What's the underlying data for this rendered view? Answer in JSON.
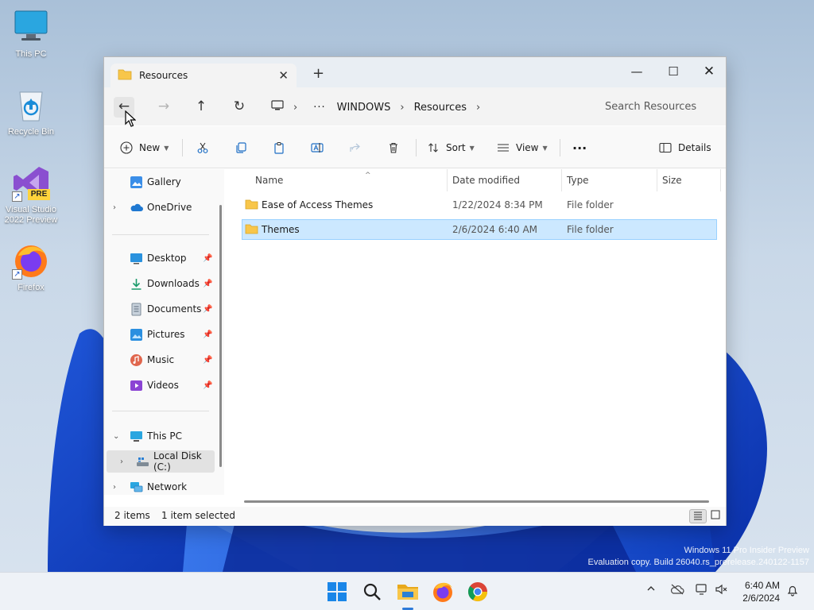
{
  "desktop": {
    "icons": [
      {
        "label": "This PC"
      },
      {
        "label": "Recycle Bin"
      },
      {
        "label": "Visual Studio 2022 Preview",
        "badge": "PRE"
      },
      {
        "label": "Firefox"
      }
    ],
    "watermark": {
      "line1": "Windows 11 Pro Insider Preview",
      "line2": "Evaluation copy. Build 26040.rs_prerelease.240122-1157"
    }
  },
  "window": {
    "tab": {
      "title": "Resources",
      "close_glyph": "✕"
    },
    "new_tab_glyph": "+",
    "controls": {
      "minimize": "—",
      "maximize": "☐",
      "close": "✕"
    },
    "nav": {
      "back": "←",
      "forward": "→",
      "up": "↑",
      "refresh": "↻"
    },
    "address": {
      "more": "···",
      "separator": "›",
      "crumbs": [
        "WINDOWS",
        "Resources"
      ]
    },
    "search_placeholder": "Search Resources",
    "commands": {
      "new": "New",
      "sort": "Sort",
      "view": "View",
      "more": "···",
      "details": "Details"
    },
    "sidebar": {
      "gallery": "Gallery",
      "onedrive": "OneDrive",
      "desktop": "Desktop",
      "downloads": "Downloads",
      "documents": "Documents",
      "pictures": "Pictures",
      "music": "Music",
      "videos": "Videos",
      "thispc": "This PC",
      "localdisk": "Local Disk (C:)",
      "network": "Network"
    },
    "columns": {
      "name": "Name",
      "date": "Date modified",
      "type": "Type",
      "size": "Size"
    },
    "files": [
      {
        "name": "Ease of Access Themes",
        "date": "1/22/2024 8:34 PM",
        "type": "File folder"
      },
      {
        "name": "Themes",
        "date": "2/6/2024 6:40 AM",
        "type": "File folder"
      }
    ],
    "status": {
      "count": "2 items",
      "selection": "1 item selected"
    }
  },
  "taskbar": {
    "time": "6:40 AM",
    "date": "2/6/2024"
  },
  "colors": {
    "accent": "#0067c0",
    "selection": "#cce8ff",
    "folder": "#f8c64a"
  }
}
